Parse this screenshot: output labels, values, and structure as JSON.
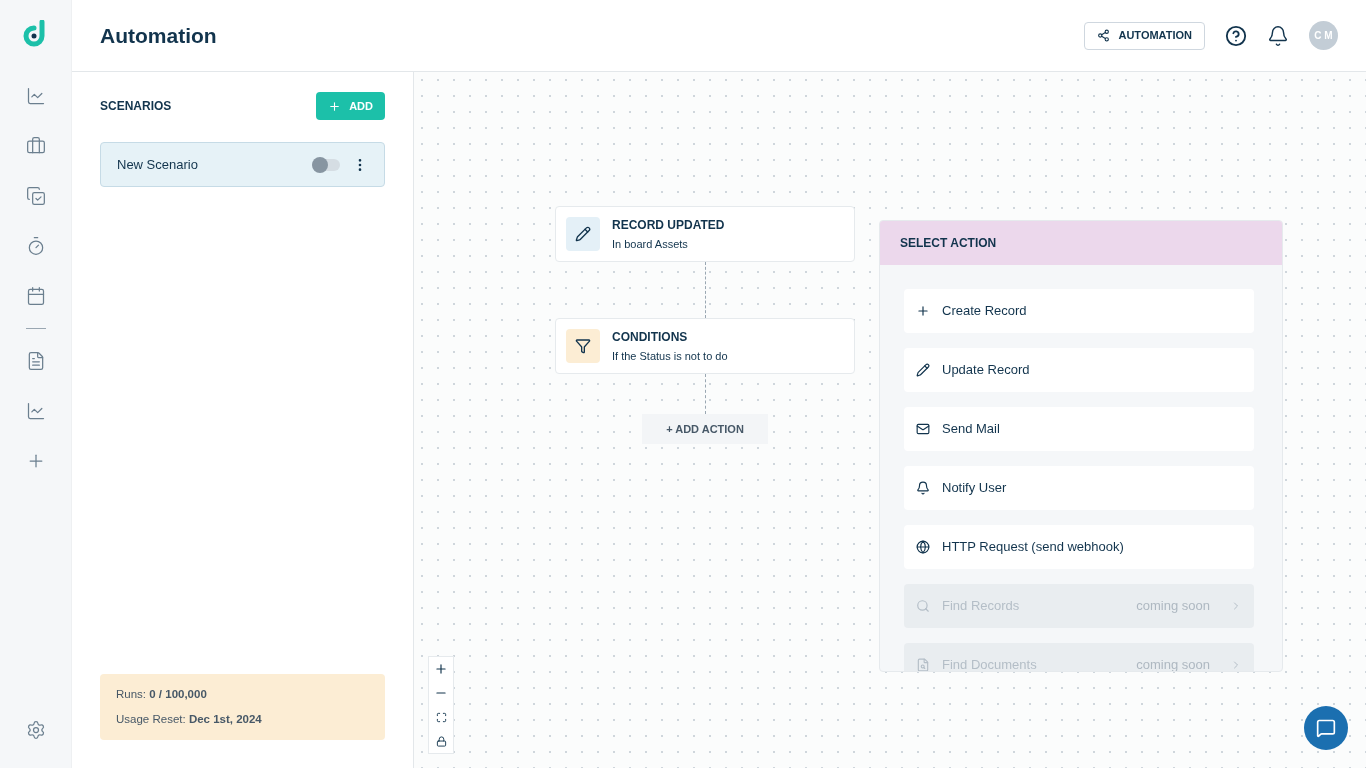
{
  "header": {
    "title": "Automation",
    "automation_button": "AUTOMATION",
    "avatar": "C M"
  },
  "scenarios": {
    "title": "SCENARIOS",
    "add_button": "ADD",
    "items": [
      {
        "name": "New Scenario",
        "on": false,
        "selected": true
      }
    ]
  },
  "usage": {
    "runs": "Runs: **0 / 100,000**",
    "reset": "Usage Reset: **Dec 1st, 2024**"
  },
  "nodes": [
    {
      "kind": "trigger",
      "title": "RECORD UPDATED",
      "subtitle": "In board Assets"
    },
    {
      "kind": "condition",
      "title": "CONDITIONS",
      "subtitle": "If the Status is not to do"
    }
  ],
  "add_action": "+ ADD ACTION",
  "select_action": {
    "title": "SELECT ACTION",
    "actions": [
      {
        "kind": "create",
        "label": "Create Record",
        "disabled": false
      },
      {
        "kind": "update",
        "label": "Update Record",
        "disabled": false
      },
      {
        "kind": "mail",
        "label": "Send Mail",
        "disabled": false
      },
      {
        "kind": "notify",
        "label": "Notify User",
        "disabled": false
      },
      {
        "kind": "http",
        "label": "HTTP Request (send webhook)",
        "disabled": false
      },
      {
        "kind": "find-records",
        "label": "Find Records",
        "disabled": true,
        "note": "coming soon"
      },
      {
        "kind": "find-documents",
        "label": "Find Documents",
        "disabled": true,
        "note": "coming soon"
      }
    ]
  }
}
